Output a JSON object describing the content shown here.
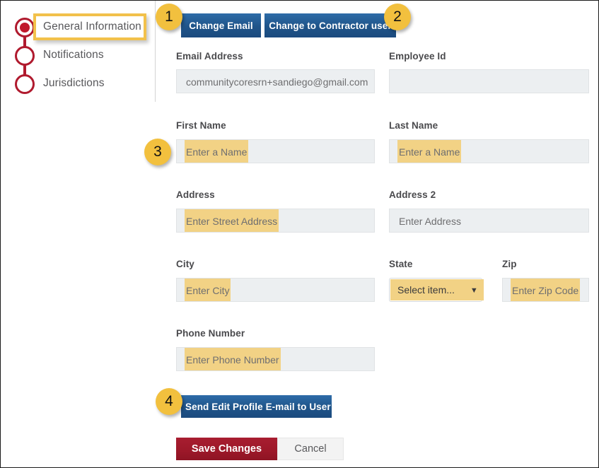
{
  "sidebar": {
    "steps": [
      {
        "label": "General Information",
        "state": "active"
      },
      {
        "label": "Notifications",
        "state": "inactive"
      },
      {
        "label": "Jurisdictions",
        "state": "inactive"
      }
    ]
  },
  "toolbar": {
    "change_email_label": "Change Email",
    "change_role_label": "Change to Contractor user"
  },
  "form": {
    "email_address": {
      "label": "Email Address",
      "value": "communitycoresrn+sandiego@gmail.com",
      "placeholder": ""
    },
    "employee_id": {
      "label": "Employee Id",
      "value": "",
      "placeholder": ""
    },
    "first_name": {
      "label": "First Name",
      "value": "",
      "placeholder": "Enter a Name"
    },
    "last_name": {
      "label": "Last Name",
      "value": "",
      "placeholder": "Enter a Name"
    },
    "address": {
      "label": "Address",
      "value": "",
      "placeholder": "Enter Street Address"
    },
    "address2": {
      "label": "Address 2",
      "value": "",
      "placeholder": "Enter Address"
    },
    "city": {
      "label": "City",
      "value": "",
      "placeholder": "Enter City"
    },
    "state": {
      "label": "State",
      "value": "Select item...",
      "placeholder": "Select item..."
    },
    "zip": {
      "label": "Zip",
      "value": "",
      "placeholder": "Enter Zip Code"
    },
    "phone": {
      "label": "Phone Number",
      "value": "",
      "placeholder": "Enter Phone Number"
    }
  },
  "actions": {
    "send_email_label": "Send Edit Profile E-mail to User",
    "save_label": "Save Changes",
    "cancel_label": "Cancel"
  },
  "callouts": [
    {
      "number": "1"
    },
    {
      "number": "2"
    },
    {
      "number": "3"
    },
    {
      "number": "4"
    }
  ],
  "icons": {
    "caret": "▼"
  },
  "colors": {
    "accent_blue": "#1f5489",
    "accent_red": "#9c1829",
    "highlight_yellow": "#f2d285",
    "callout_yellow": "#f2c03e",
    "step_red": "#b01a2e",
    "field_gray": "#eceff1"
  }
}
